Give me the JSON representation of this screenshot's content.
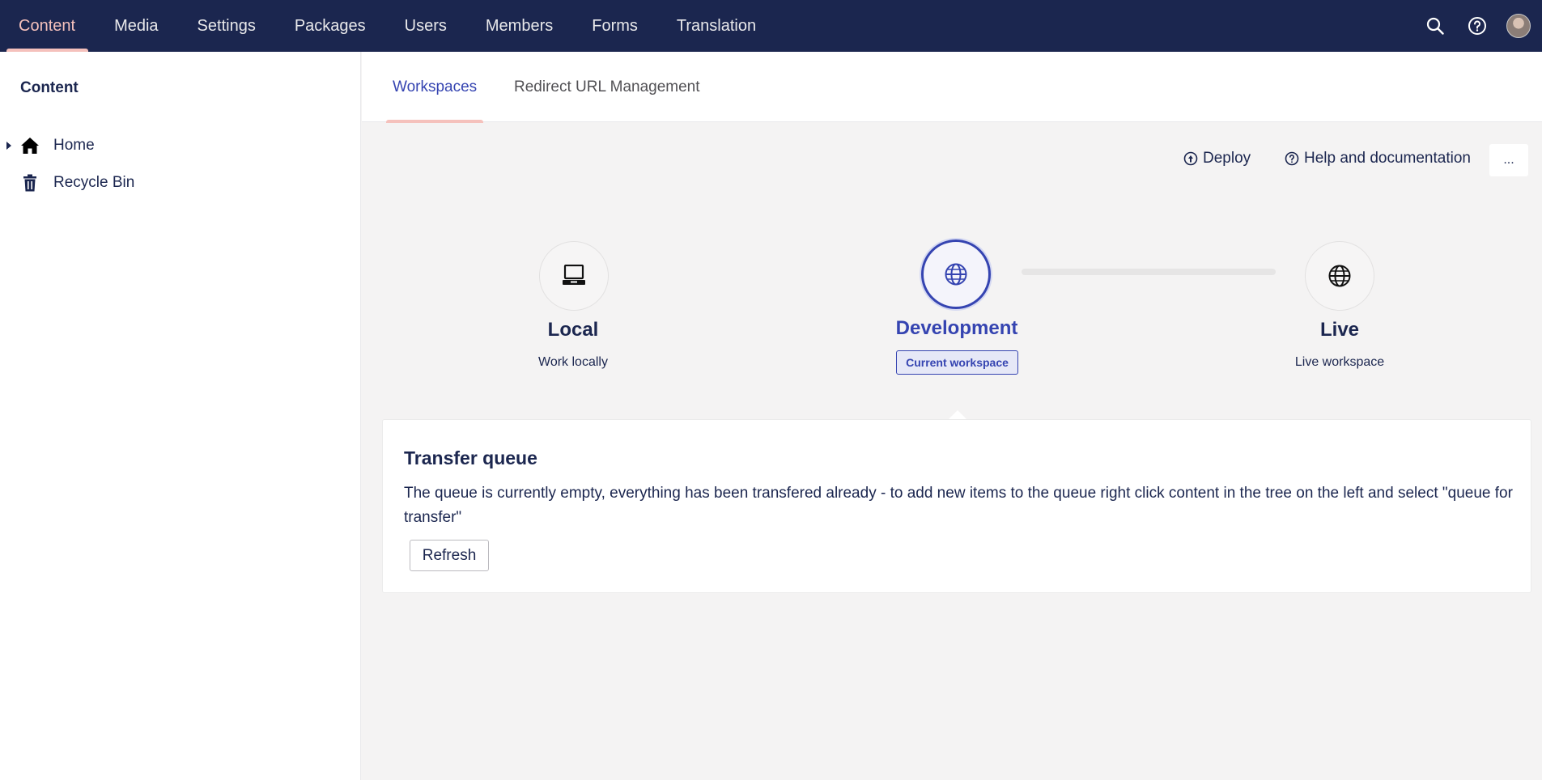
{
  "topnav": {
    "items": [
      {
        "label": "Content",
        "active": true
      },
      {
        "label": "Media"
      },
      {
        "label": "Settings"
      },
      {
        "label": "Packages"
      },
      {
        "label": "Users"
      },
      {
        "label": "Members"
      },
      {
        "label": "Forms"
      },
      {
        "label": "Translation"
      }
    ],
    "icons": [
      "search-icon",
      "help-icon",
      "user-avatar"
    ]
  },
  "sidebar": {
    "title": "Content",
    "items": [
      {
        "label": "Home",
        "icon": "home-icon",
        "expandable": true
      },
      {
        "label": "Recycle Bin",
        "icon": "trash-icon"
      }
    ]
  },
  "tabs": [
    {
      "label": "Workspaces",
      "active": true
    },
    {
      "label": "Redirect URL Management"
    }
  ],
  "toolbar": {
    "deploy_label": "Deploy",
    "help_label": "Help and documentation",
    "more_label": "..."
  },
  "workspaces": [
    {
      "name": "Local",
      "description": "Work locally",
      "icon": "laptop-icon"
    },
    {
      "name": "Development",
      "badge": "Current workspace",
      "icon": "globe-icon",
      "current": true
    },
    {
      "name": "Live",
      "description": "Live workspace",
      "icon": "globe-icon"
    }
  ],
  "transfer_queue": {
    "title": "Transfer queue",
    "message": "The queue is currently empty, everything has been transfered already - to add new items to the queue right click content in the tree on the left and select \"queue for transfer\"",
    "refresh_label": "Refresh"
  },
  "colors": {
    "header_bg": "#1b264f",
    "accent": "#f5c1bc",
    "primary": "#3544b1"
  }
}
